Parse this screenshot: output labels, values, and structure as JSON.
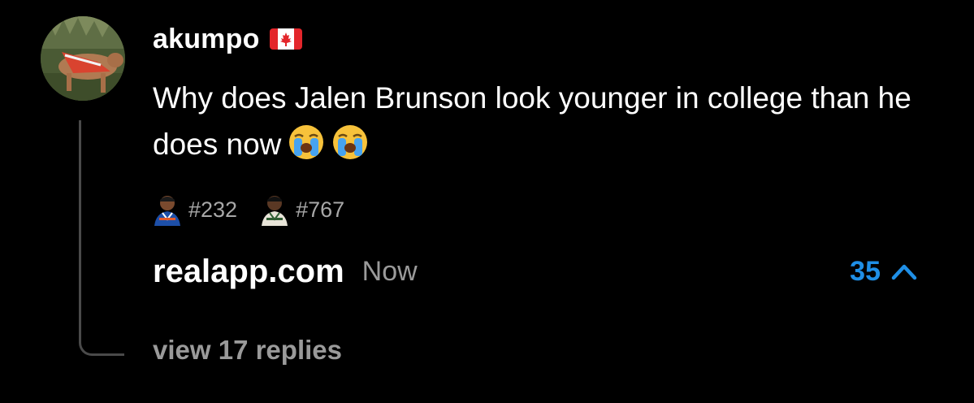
{
  "comment": {
    "username": "akumpo",
    "flag_icon": "canada-flag-icon",
    "avatar_icon": "dog-avatar",
    "text": "Why does Jalen Brunson look younger in college than he does now",
    "emoji_icon": "loudly-crying-face-emoji",
    "emoji_count": 2
  },
  "tags": [
    {
      "label": "#232",
      "icon": "player-avatar-knicks"
    },
    {
      "label": "#767",
      "icon": "player-avatar-bucks"
    }
  ],
  "footer": {
    "source": "realapp.com",
    "timestamp": "Now",
    "vote_count": "35",
    "vote_icon": "chevron-up-icon"
  },
  "replies": {
    "label": "view 17 replies"
  },
  "colors": {
    "background": "#000000",
    "text_primary": "#ffffff",
    "text_secondary": "#9a9a9a",
    "accent": "#1f8fe6",
    "thread_line": "#4a4a4a"
  }
}
